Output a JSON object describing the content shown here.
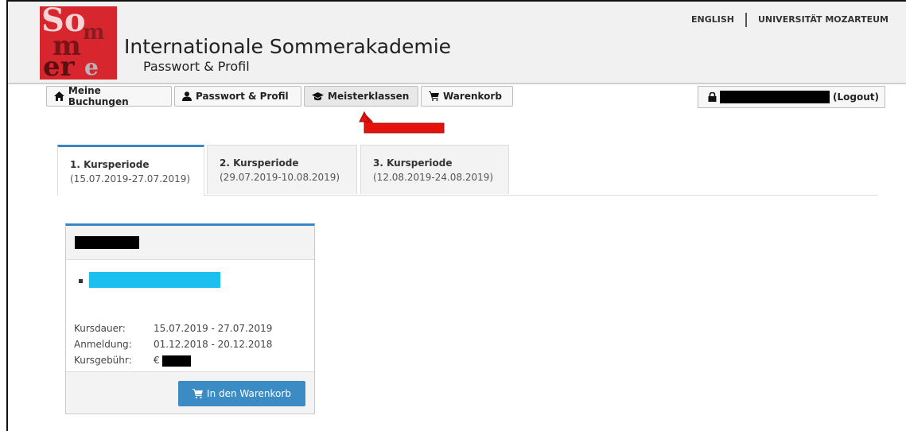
{
  "header": {
    "title": "Internationale Sommerakademie",
    "subtitle": "Passwort & Profil",
    "logo_text": "So m m er",
    "links": {
      "english": "ENGLISH",
      "university": "UNIVERSITÄT MOZARTEUM"
    }
  },
  "nav": {
    "items": [
      {
        "label": "Meine Buchungen",
        "icon": "home-icon"
      },
      {
        "label": "Passwort & Profil",
        "icon": "user-icon"
      },
      {
        "label": "Meisterklassen",
        "icon": "graduation-cap-icon"
      },
      {
        "label": "Warenkorb",
        "icon": "cart-icon"
      }
    ],
    "active": "Meisterklassen",
    "logout_label": "(Logout)"
  },
  "tabs": [
    {
      "title": "1. Kursperiode",
      "dates": "(15.07.2019-27.07.2019)"
    },
    {
      "title": "2. Kursperiode",
      "dates": "(29.07.2019-10.08.2019)"
    },
    {
      "title": "3. Kursperiode",
      "dates": "(12.08.2019-24.08.2019)"
    }
  ],
  "card": {
    "rows": [
      {
        "label": "Kursdauer:",
        "value": "15.07.2019 - 27.07.2019"
      },
      {
        "label": "Anmeldung:",
        "value": "01.12.2018 - 20.12.2018"
      },
      {
        "label": "Kursgebühr:",
        "value": "€"
      }
    ],
    "button_label": "In den Warenkorb"
  },
  "colors": {
    "accent": "#3a86c2",
    "logo": "#d7262e",
    "highlight": "#1cc0ef",
    "arrow": "#e3120b"
  }
}
